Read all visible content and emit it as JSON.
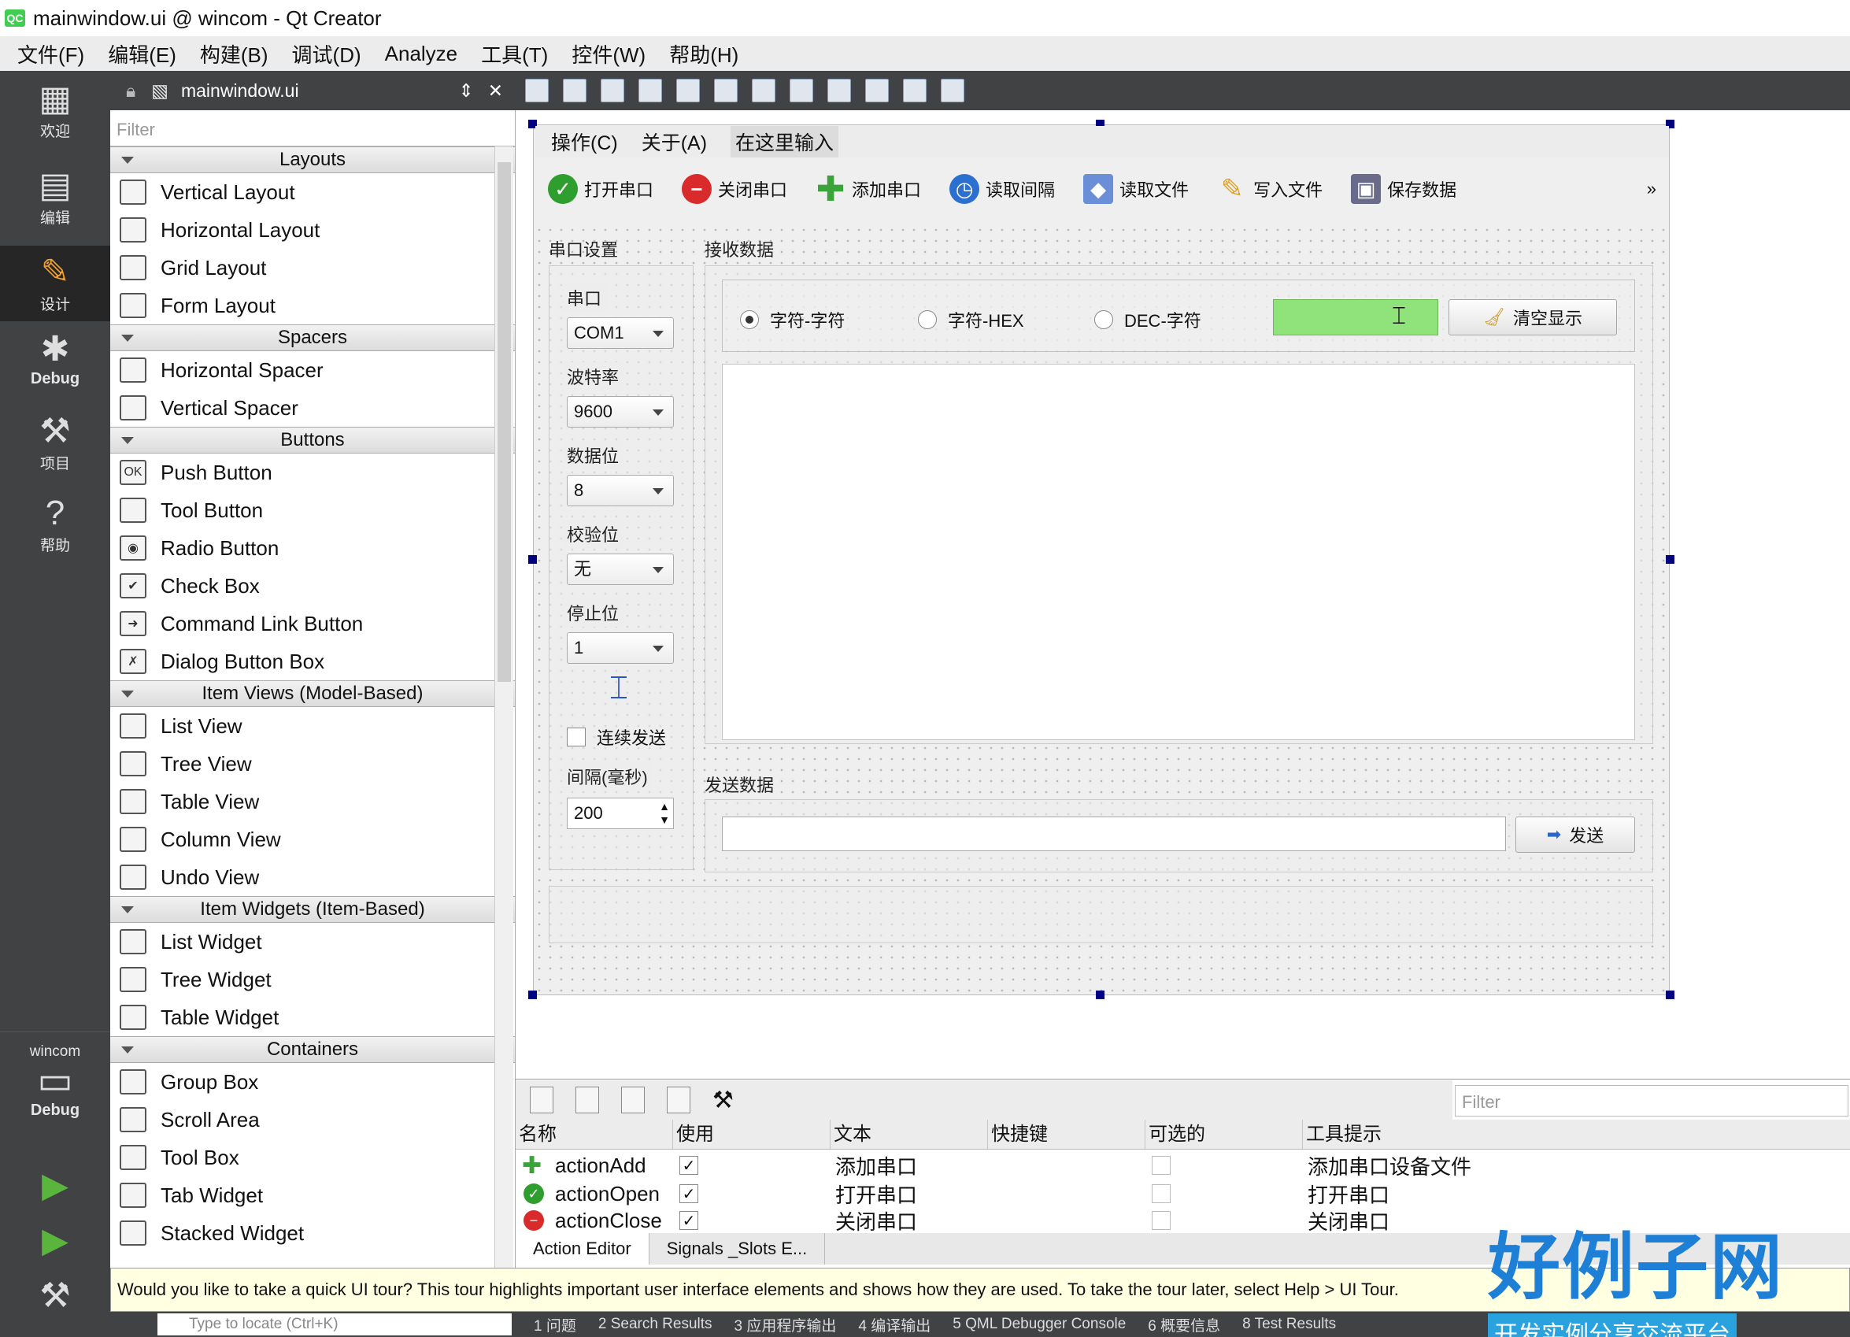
{
  "window": {
    "title": "mainwindow.ui @ wincom - Qt Creator",
    "app_icon": "QC"
  },
  "menubar": [
    "文件(F)",
    "编辑(E)",
    "构建(B)",
    "调试(D)",
    "Analyze",
    "工具(T)",
    "控件(W)",
    "帮助(H)"
  ],
  "modebar": {
    "modes": [
      {
        "label": "欢迎",
        "icon": "grid-icon"
      },
      {
        "label": "编辑",
        "icon": "document-icon"
      },
      {
        "label": "设计",
        "icon": "pencil-icon"
      },
      {
        "label": "Debug",
        "icon": "bug-icon"
      },
      {
        "label": "项目",
        "icon": "wrench-icon"
      },
      {
        "label": "帮助",
        "icon": "help-icon"
      }
    ],
    "project": "wincom",
    "kit": "Debug"
  },
  "editor": {
    "file": "mainwindow.ui"
  },
  "widgetbox": {
    "filter_placeholder": "Filter",
    "categories": [
      {
        "name": "Layouts",
        "items": [
          "Vertical Layout",
          "Horizontal Layout",
          "Grid Layout",
          "Form Layout"
        ]
      },
      {
        "name": "Spacers",
        "items": [
          "Horizontal Spacer",
          "Vertical Spacer"
        ]
      },
      {
        "name": "Buttons",
        "items": [
          "Push Button",
          "Tool Button",
          "Radio Button",
          "Check Box",
          "Command Link Button",
          "Dialog Button Box"
        ]
      },
      {
        "name": "Item Views (Model-Based)",
        "items": [
          "List View",
          "Tree View",
          "Table View",
          "Column View",
          "Undo View"
        ]
      },
      {
        "name": "Item Widgets (Item-Based)",
        "items": [
          "List Widget",
          "Tree Widget",
          "Table Widget"
        ]
      },
      {
        "name": "Containers",
        "items": [
          "Group Box",
          "Scroll Area",
          "Tool Box",
          "Tab Widget",
          "Stacked Widget"
        ]
      }
    ]
  },
  "form": {
    "menu": [
      "操作(C)",
      "关于(A)",
      "在这里输入"
    ],
    "toolbar": [
      {
        "label": "打开串口",
        "color": "#2e9e2e"
      },
      {
        "label": "关闭串口",
        "color": "#d92b2b"
      },
      {
        "label": "添加串口",
        "color": "#3aa43a"
      },
      {
        "label": "读取间隔",
        "color": "#2b6fd1"
      },
      {
        "label": "读取文件",
        "color": "#6b8fd6"
      },
      {
        "label": "写入文件",
        "color": "#e0a020"
      },
      {
        "label": "保存数据",
        "color": "#6a6a8a"
      }
    ],
    "more": "»",
    "serial_group": {
      "title": "串口设置",
      "fields": [
        {
          "label": "串口",
          "value": "COM1"
        },
        {
          "label": "波特率",
          "value": "9600"
        },
        {
          "label": "数据位",
          "value": "8"
        },
        {
          "label": "校验位",
          "value": "无"
        },
        {
          "label": "停止位",
          "value": "1"
        }
      ],
      "continuous_send": "连续发送",
      "interval_label": "间隔(毫秒)",
      "interval_value": "200"
    },
    "receive_group": {
      "title": "接收数据",
      "modes": [
        "字符-字符",
        "字符-HEX",
        "DEC-字符"
      ],
      "selected_mode": 0,
      "clear_button": "清空显示"
    },
    "send_group": {
      "title": "发送数据",
      "send_button": "发送"
    }
  },
  "action_editor": {
    "filter_placeholder": "Filter",
    "columns": [
      "名称",
      "使用",
      "文本",
      "快捷键",
      "可选的",
      "工具提示"
    ],
    "rows": [
      {
        "name": "actionAdd",
        "used": true,
        "text": "添加串口",
        "shortcut": "",
        "checkable": false,
        "tooltip": "添加串口设备文件",
        "icon": "plus-icon"
      },
      {
        "name": "actionOpen",
        "used": true,
        "text": "打开串口",
        "shortcut": "",
        "checkable": false,
        "tooltip": "打开串口",
        "icon": "check-circle-icon"
      },
      {
        "name": "actionClose",
        "used": true,
        "text": "关闭串口",
        "shortcut": "",
        "checkable": false,
        "tooltip": "关闭串口",
        "icon": "stop-circle-icon"
      }
    ],
    "tabs": [
      "Action Editor",
      "Signals _Slots E..."
    ]
  },
  "tour": "Would you like to take a quick UI tour? This tour highlights important user interface elements and shows how they are used. To take the tour later, select Help > UI Tour.",
  "statusbar": {
    "locate_placeholder": "Type to locate (Ctrl+K)",
    "outputs": [
      "1 问题",
      "2 Search Results",
      "3 应用程序输出",
      "4 编译输出",
      "5 QML Debugger Console",
      "6 概要信息",
      "8 Test Results"
    ]
  },
  "brand": {
    "title": "好例子网",
    "subtitle": "开发实例分享交流平台"
  }
}
